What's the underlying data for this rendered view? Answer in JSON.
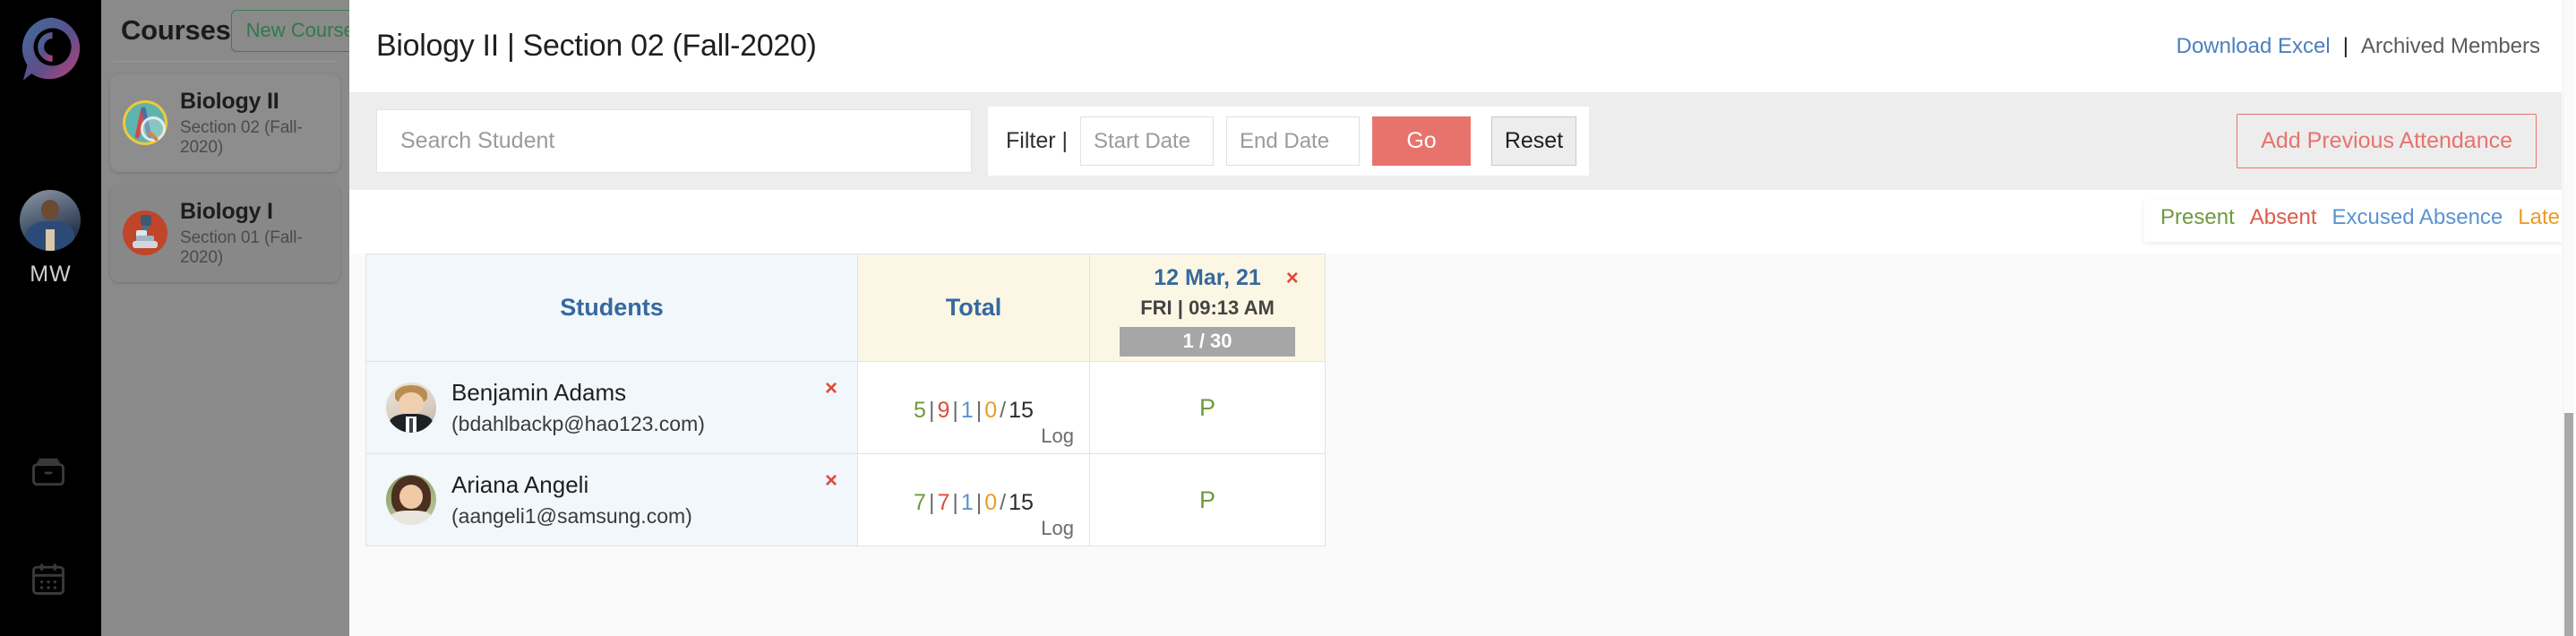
{
  "rail": {
    "logo_name": "logo-c-icon",
    "user_initials": "MW",
    "icons": [
      {
        "name": "bag-icon"
      },
      {
        "name": "calendar-icon"
      }
    ]
  },
  "courses_panel": {
    "title": "Courses",
    "new_course_label": "New Course",
    "items": [
      {
        "name": "Biology II",
        "section": "Section 02 (Fall-2020)",
        "icon": "dna-magnifier-icon",
        "active": true
      },
      {
        "name": "Biology I",
        "section": "Section 01 (Fall-2020)",
        "icon": "microscope-icon",
        "active": false
      }
    ]
  },
  "header": {
    "page_title": "Biology II | Section 02 (Fall-2020)",
    "download_excel": "Download Excel",
    "divider": "|",
    "archived_members": "Archived Members"
  },
  "toolbar": {
    "search_placeholder": "Search Student",
    "search_value": "",
    "filter_label": "Filter |",
    "start_date_placeholder": "Start Date",
    "start_date_value": "",
    "end_date_placeholder": "End Date",
    "end_date_value": "",
    "go_label": "Go",
    "reset_label": "Reset",
    "add_previous_attendance": "Add Previous Attendance"
  },
  "legend": {
    "present": "Present",
    "absent": "Absent",
    "excused": "Excused Absence",
    "late": "Late",
    "colors": {
      "present": "#6f9a3e",
      "absent": "#dd5b4a",
      "excused": "#5b93cf",
      "late": "#ec9b25"
    }
  },
  "table": {
    "headers": {
      "students": "Students",
      "total": "Total",
      "date_main": "12 Mar, 21",
      "date_sub": "FRI | 09:13 AM",
      "date_count": "1 / 30",
      "date_remove": "×"
    },
    "log_label": "Log",
    "remove_label": "×",
    "rows": [
      {
        "name": "Benjamin Adams",
        "email": "(bdahlbackp@hao123.com)",
        "avatar": "male-student-avatar",
        "present": "5",
        "absent": "9",
        "excused": "1",
        "late": "0",
        "total": "15",
        "attendance": "P"
      },
      {
        "name": "Ariana Angeli",
        "email": "(aangeli1@samsung.com)",
        "avatar": "female-student-avatar",
        "present": "7",
        "absent": "7",
        "excused": "1",
        "late": "0",
        "total": "15",
        "attendance": "P"
      }
    ]
  }
}
